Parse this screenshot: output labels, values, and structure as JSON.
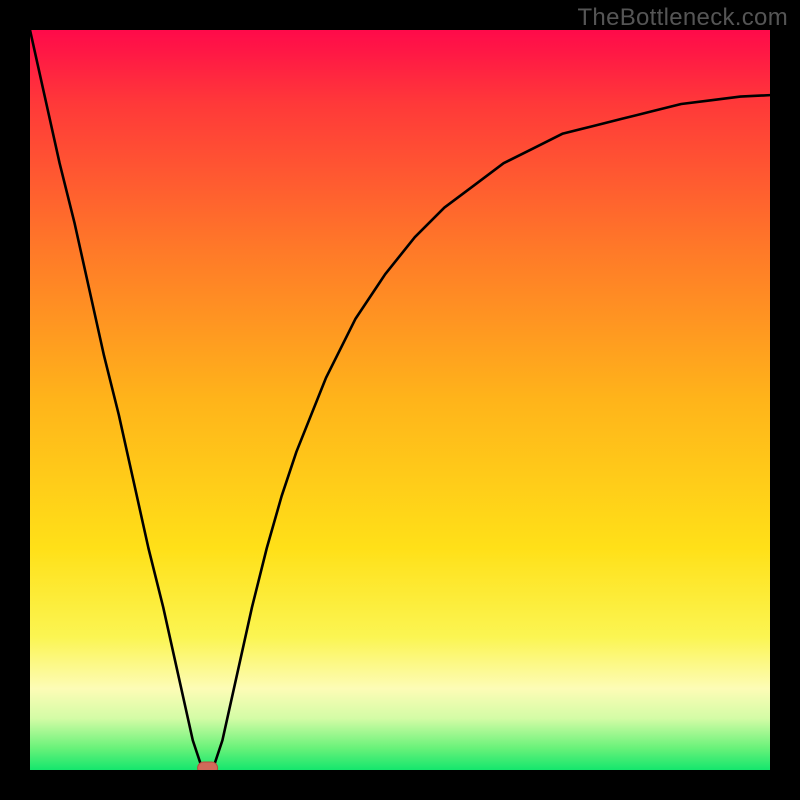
{
  "watermark": "TheBottleneck.com",
  "chart_data": {
    "type": "line",
    "title": "",
    "xlabel": "",
    "ylabel": "",
    "xlim": [
      0,
      100
    ],
    "ylim": [
      0,
      100
    ],
    "x": [
      0,
      2,
      4,
      6,
      8,
      10,
      12,
      14,
      16,
      18,
      20,
      22,
      23,
      24,
      25,
      26,
      28,
      30,
      32,
      34,
      36,
      40,
      44,
      48,
      52,
      56,
      60,
      64,
      68,
      72,
      76,
      80,
      84,
      88,
      92,
      96,
      100
    ],
    "y": [
      100,
      91,
      82,
      74,
      65,
      56,
      48,
      39,
      30,
      22,
      13,
      4,
      1,
      0,
      1,
      4,
      13,
      22,
      30,
      37,
      43,
      53,
      61,
      67,
      72,
      76,
      79,
      82,
      84,
      86,
      87,
      88,
      89,
      90,
      90.5,
      91,
      91.2
    ],
    "marker": {
      "x": 24,
      "y": 0,
      "color": "#d16a5a",
      "shape": "pill"
    },
    "background_gradient": [
      "#ff0a4a",
      "#ff7a28",
      "#ffe018",
      "#fdfcb6",
      "#14e66d"
    ],
    "line_color": "#000000"
  }
}
